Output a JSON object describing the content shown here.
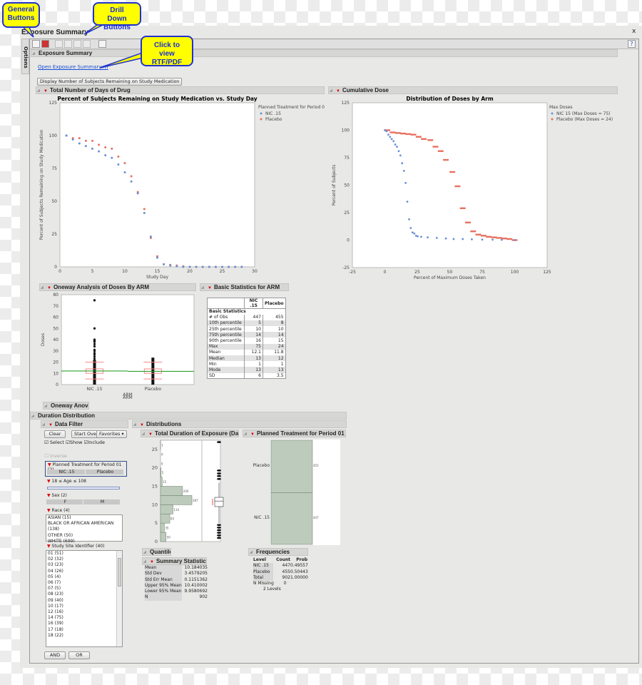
{
  "window": {
    "title": "Exposure Summary",
    "close": "x",
    "options_tab": "Options",
    "help": "?"
  },
  "callouts": {
    "general": "General Buttons",
    "drill": "Drill Down Buttons",
    "rtf": "Click to view RTF/PDF"
  },
  "toolbar": {
    "buttons": [
      "data-table-icon",
      "report-icon",
      "drill-1-icon",
      "drill-2-icon",
      "drill-3-icon",
      "filter-icon",
      "tools-icon"
    ]
  },
  "report": {
    "header": "Exposure Summary",
    "link": "Open Exposure Summary.rtf",
    "display_button": "Display Number of Subjects Remaining on Study Medication"
  },
  "sections": {
    "days": "Total Number of Days of Drug",
    "cumulative": "Cumulative Dose",
    "oneway": "Oneway Analysis of Doses By ARM",
    "basic": "Basic Statistics for ARM",
    "anova": "Oneway Anova",
    "duration": "Duration Distribution",
    "filter": "Data Filter",
    "distributions": "Distributions",
    "total_duration": "Total Duration of Exposure (Days)",
    "planned": "Planned Treatment for Period 01",
    "quantiles": "Quantiles",
    "summary": "Summary Statistics",
    "frequencies": "Frequencies"
  },
  "colors": {
    "blue": "#6b8fd6",
    "red": "#e8705f",
    "green": "#2ca02c",
    "bar": "#bccbbb"
  },
  "chart_data": [
    {
      "type": "scatter",
      "title": "Percent of Subjects Remaining on Study Medication vs. Study Day",
      "xlabel": "Study Day",
      "ylabel": "Percent of Subjects Remaining on Study Medication",
      "xlim": [
        0,
        30
      ],
      "ylim": [
        0,
        125
      ],
      "xticks": [
        0,
        5,
        10,
        15,
        20,
        25,
        30
      ],
      "yticks": [
        0,
        25,
        50,
        75,
        100,
        125
      ],
      "legend_title": "Planned Treatment for Period 01",
      "legend": "right",
      "x": [
        1,
        2,
        3,
        4,
        5,
        6,
        7,
        8,
        9,
        10,
        11,
        12,
        13,
        14,
        15,
        16,
        17,
        18,
        19,
        20,
        21,
        22,
        23,
        24,
        25,
        26,
        27,
        28
      ],
      "series": [
        {
          "name": "NIC .15",
          "values": [
            100,
            97,
            94,
            92,
            90,
            88,
            85,
            83,
            78,
            72,
            65,
            56,
            41,
            23,
            7,
            2,
            1,
            0.5,
            0,
            0,
            0,
            0,
            0,
            0,
            0,
            0,
            0,
            0
          ]
        },
        {
          "name": "Placebo",
          "values": [
            100,
            98,
            98,
            96,
            96,
            93,
            91,
            90,
            84,
            79,
            69,
            57,
            44,
            22,
            8,
            2,
            1.5,
            1,
            0.5,
            0,
            0,
            0,
            0,
            0,
            0,
            0,
            0,
            0
          ]
        }
      ]
    },
    {
      "type": "scatter",
      "title": "Distribution of Doses by Arm",
      "xlabel": "Percent of Maximum Doses Taken",
      "ylabel": "Percent of Subjects",
      "xlim": [
        -25,
        125
      ],
      "ylim": [
        -25,
        125
      ],
      "xticks": [
        -25,
        0,
        25,
        50,
        75,
        100,
        125
      ],
      "yticks": [
        -25,
        0,
        25,
        50,
        75,
        100,
        125
      ],
      "legend_title": "Max Doses",
      "legend": "right",
      "series": [
        {
          "name": "NIC 15 (Max Doses = 75)",
          "x": [
            0,
            1.3,
            2.7,
            4,
            5.3,
            6.7,
            8,
            9.3,
            10.7,
            12,
            13.3,
            14.7,
            16,
            17.3,
            18.7,
            20,
            21.3,
            22.7,
            24,
            25.3,
            28,
            33,
            40,
            47,
            53,
            60,
            67,
            75,
            83,
            90,
            100
          ],
          "y": [
            100,
            99,
            96,
            94,
            92,
            90,
            87,
            85,
            81,
            77,
            70,
            63,
            52,
            35,
            19,
            11,
            7,
            6,
            4,
            3.5,
            3,
            2.5,
            2,
            1.5,
            1,
            1,
            0.7,
            0.5,
            0.4,
            0.3,
            0
          ]
        },
        {
          "name": "Placebo (Max Doses = 24)",
          "x": [
            2,
            6,
            10,
            14,
            18,
            22,
            26,
            30,
            35,
            39,
            43,
            47,
            52,
            56,
            60,
            64,
            68,
            72,
            76,
            80,
            84,
            88,
            92,
            96,
            100
          ],
          "y": [
            100,
            98,
            97.5,
            97,
            96.5,
            96,
            94,
            92,
            91,
            85,
            81,
            73,
            62,
            49,
            29,
            16,
            8,
            5,
            4,
            3,
            2.5,
            2,
            1.5,
            1,
            0
          ]
        }
      ]
    },
    {
      "type": "scatter",
      "subtype": "oneway",
      "xlabel": "ARM",
      "ylabel": "Doses",
      "ylim": [
        0,
        80
      ],
      "yticks": [
        0,
        10,
        20,
        30,
        40,
        50,
        60,
        70,
        80
      ],
      "categories": [
        "NIC .15",
        "Placebo"
      ],
      "ranges": [
        [
          0,
          22
        ],
        [
          0,
          24
        ]
      ],
      "outliers": [
        [
          75,
          50,
          40,
          39,
          38,
          36,
          34,
          31,
          30,
          28,
          27,
          25,
          23
        ],
        []
      ],
      "means": [
        12.1,
        11.8
      ],
      "quartiles": [
        [
          10,
          14
        ],
        [
          10,
          14
        ]
      ],
      "whiskers": [
        [
          5,
          20
        ],
        [
          5,
          20
        ]
      ]
    },
    {
      "type": "bar",
      "subtype": "histogram",
      "orientation": "horizontal",
      "ylabel": "",
      "ylim": [
        0,
        27.5
      ],
      "yticks": [
        0,
        5,
        10,
        15,
        20,
        25
      ],
      "bin_edges": [
        0,
        2.5,
        5,
        7.5,
        10,
        12.5,
        15,
        17.5,
        20,
        22.5,
        25,
        27.5
      ],
      "counts": [
        50,
        35,
        85,
        114,
        287,
        200,
        15,
        5,
        0,
        0,
        1
      ],
      "box": {
        "median": 11,
        "q1": 9.5,
        "q3": 12,
        "whisker_low": 5,
        "whisker_high": 16,
        "outliers": [
          1,
          1.7,
          2.4,
          3.1,
          3.8,
          4.5,
          17,
          17.8,
          18.5,
          19.3,
          27
        ]
      }
    },
    {
      "type": "bar",
      "subtype": "mosaic",
      "categories": [
        "Placebo",
        "NIC .15"
      ],
      "values": [
        455,
        447
      ]
    }
  ],
  "basic_stats": {
    "columns": [
      "",
      "NIC .15",
      "Placebo"
    ],
    "group": "Basic Statistics",
    "rows": [
      [
        "# of Obs",
        "447",
        "455"
      ],
      [
        "10th percentile",
        "5",
        "8"
      ],
      [
        "25th percentile",
        "10",
        "10"
      ],
      [
        "75th percentile",
        "14",
        "14"
      ],
      [
        "90th percentile",
        "16",
        "15"
      ],
      [
        "Max",
        "75",
        "24"
      ],
      [
        "Mean",
        "12.1",
        "11.8"
      ],
      [
        "Median",
        "13",
        "12"
      ],
      [
        "Min",
        "1",
        "1"
      ],
      [
        "Mode",
        "13",
        "13"
      ],
      [
        "SD",
        "6",
        "3.5"
      ]
    ]
  },
  "filter": {
    "clear": "Clear",
    "start_over": "Start Over",
    "favorites": "Favorites ▾",
    "select": "Select",
    "show": "Show",
    "include": "Include",
    "inverse": "Inverse",
    "treatment": {
      "title": "Planned Treatment for Period 01 (2)",
      "options": [
        "NIC .15",
        "Placebo"
      ]
    },
    "age": "18 ≤ Age ≤ 108",
    "sex": {
      "title": "Sex (2)",
      "options": [
        "F",
        "M"
      ]
    },
    "race": {
      "title": "Race (4)",
      "items": [
        "ASIAN (15)",
        "BLACK OR AFRICAN AMERICAN (138)",
        "OTHER (50)",
        "WHITE (699)"
      ]
    },
    "site": {
      "title": "Study Site Identifier (40)",
      "items": [
        "01 (51)",
        "02 (32)",
        "03 (23)",
        "04 (26)",
        "05 (4)",
        "06 (7)",
        "07 (5)",
        "08 (23)",
        "09 (40)",
        "10 (17)",
        "12 (16)",
        "14 (75)",
        "16 (39)",
        "17 (18)",
        "18 (22)"
      ]
    },
    "and": "AND",
    "or": "OR"
  },
  "summary_stats": {
    "rows": [
      [
        "Mean",
        "10.184035"
      ],
      [
        "Std Dev",
        "3.4579205"
      ],
      [
        "Std Err Mean",
        "0.1151362"
      ],
      [
        "Upper 95% Mean",
        "10.410002"
      ],
      [
        "Lower 95% Mean",
        "9.9580692"
      ],
      [
        "N",
        "902"
      ]
    ]
  },
  "frequencies": {
    "columns": [
      "Level",
      "Count",
      "Prob"
    ],
    "rows": [
      [
        "NIC .15",
        "447",
        "0.49557"
      ],
      [
        "Placebo",
        "455",
        "0.50443"
      ],
      [
        "Total",
        "902",
        "1.00000"
      ]
    ],
    "missing_label": "N Missing",
    "missing": "0",
    "levels": "2  Levels"
  }
}
